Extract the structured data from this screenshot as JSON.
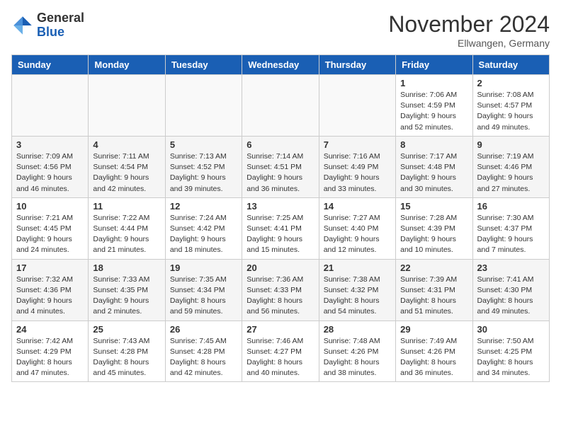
{
  "header": {
    "logo_general": "General",
    "logo_blue": "Blue",
    "month_title": "November 2024",
    "location": "Ellwangen, Germany"
  },
  "columns": [
    "Sunday",
    "Monday",
    "Tuesday",
    "Wednesday",
    "Thursday",
    "Friday",
    "Saturday"
  ],
  "weeks": [
    {
      "days": [
        {
          "num": "",
          "info": ""
        },
        {
          "num": "",
          "info": ""
        },
        {
          "num": "",
          "info": ""
        },
        {
          "num": "",
          "info": ""
        },
        {
          "num": "",
          "info": ""
        },
        {
          "num": "1",
          "info": "Sunrise: 7:06 AM\nSunset: 4:59 PM\nDaylight: 9 hours\nand 52 minutes."
        },
        {
          "num": "2",
          "info": "Sunrise: 7:08 AM\nSunset: 4:57 PM\nDaylight: 9 hours\nand 49 minutes."
        }
      ]
    },
    {
      "days": [
        {
          "num": "3",
          "info": "Sunrise: 7:09 AM\nSunset: 4:56 PM\nDaylight: 9 hours\nand 46 minutes."
        },
        {
          "num": "4",
          "info": "Sunrise: 7:11 AM\nSunset: 4:54 PM\nDaylight: 9 hours\nand 42 minutes."
        },
        {
          "num": "5",
          "info": "Sunrise: 7:13 AM\nSunset: 4:52 PM\nDaylight: 9 hours\nand 39 minutes."
        },
        {
          "num": "6",
          "info": "Sunrise: 7:14 AM\nSunset: 4:51 PM\nDaylight: 9 hours\nand 36 minutes."
        },
        {
          "num": "7",
          "info": "Sunrise: 7:16 AM\nSunset: 4:49 PM\nDaylight: 9 hours\nand 33 minutes."
        },
        {
          "num": "8",
          "info": "Sunrise: 7:17 AM\nSunset: 4:48 PM\nDaylight: 9 hours\nand 30 minutes."
        },
        {
          "num": "9",
          "info": "Sunrise: 7:19 AM\nSunset: 4:46 PM\nDaylight: 9 hours\nand 27 minutes."
        }
      ]
    },
    {
      "days": [
        {
          "num": "10",
          "info": "Sunrise: 7:21 AM\nSunset: 4:45 PM\nDaylight: 9 hours\nand 24 minutes."
        },
        {
          "num": "11",
          "info": "Sunrise: 7:22 AM\nSunset: 4:44 PM\nDaylight: 9 hours\nand 21 minutes."
        },
        {
          "num": "12",
          "info": "Sunrise: 7:24 AM\nSunset: 4:42 PM\nDaylight: 9 hours\nand 18 minutes."
        },
        {
          "num": "13",
          "info": "Sunrise: 7:25 AM\nSunset: 4:41 PM\nDaylight: 9 hours\nand 15 minutes."
        },
        {
          "num": "14",
          "info": "Sunrise: 7:27 AM\nSunset: 4:40 PM\nDaylight: 9 hours\nand 12 minutes."
        },
        {
          "num": "15",
          "info": "Sunrise: 7:28 AM\nSunset: 4:39 PM\nDaylight: 9 hours\nand 10 minutes."
        },
        {
          "num": "16",
          "info": "Sunrise: 7:30 AM\nSunset: 4:37 PM\nDaylight: 9 hours\nand 7 minutes."
        }
      ]
    },
    {
      "days": [
        {
          "num": "17",
          "info": "Sunrise: 7:32 AM\nSunset: 4:36 PM\nDaylight: 9 hours\nand 4 minutes."
        },
        {
          "num": "18",
          "info": "Sunrise: 7:33 AM\nSunset: 4:35 PM\nDaylight: 9 hours\nand 2 minutes."
        },
        {
          "num": "19",
          "info": "Sunrise: 7:35 AM\nSunset: 4:34 PM\nDaylight: 8 hours\nand 59 minutes."
        },
        {
          "num": "20",
          "info": "Sunrise: 7:36 AM\nSunset: 4:33 PM\nDaylight: 8 hours\nand 56 minutes."
        },
        {
          "num": "21",
          "info": "Sunrise: 7:38 AM\nSunset: 4:32 PM\nDaylight: 8 hours\nand 54 minutes."
        },
        {
          "num": "22",
          "info": "Sunrise: 7:39 AM\nSunset: 4:31 PM\nDaylight: 8 hours\nand 51 minutes."
        },
        {
          "num": "23",
          "info": "Sunrise: 7:41 AM\nSunset: 4:30 PM\nDaylight: 8 hours\nand 49 minutes."
        }
      ]
    },
    {
      "days": [
        {
          "num": "24",
          "info": "Sunrise: 7:42 AM\nSunset: 4:29 PM\nDaylight: 8 hours\nand 47 minutes."
        },
        {
          "num": "25",
          "info": "Sunrise: 7:43 AM\nSunset: 4:28 PM\nDaylight: 8 hours\nand 45 minutes."
        },
        {
          "num": "26",
          "info": "Sunrise: 7:45 AM\nSunset: 4:28 PM\nDaylight: 8 hours\nand 42 minutes."
        },
        {
          "num": "27",
          "info": "Sunrise: 7:46 AM\nSunset: 4:27 PM\nDaylight: 8 hours\nand 40 minutes."
        },
        {
          "num": "28",
          "info": "Sunrise: 7:48 AM\nSunset: 4:26 PM\nDaylight: 8 hours\nand 38 minutes."
        },
        {
          "num": "29",
          "info": "Sunrise: 7:49 AM\nSunset: 4:26 PM\nDaylight: 8 hours\nand 36 minutes."
        },
        {
          "num": "30",
          "info": "Sunrise: 7:50 AM\nSunset: 4:25 PM\nDaylight: 8 hours\nand 34 minutes."
        }
      ]
    }
  ]
}
